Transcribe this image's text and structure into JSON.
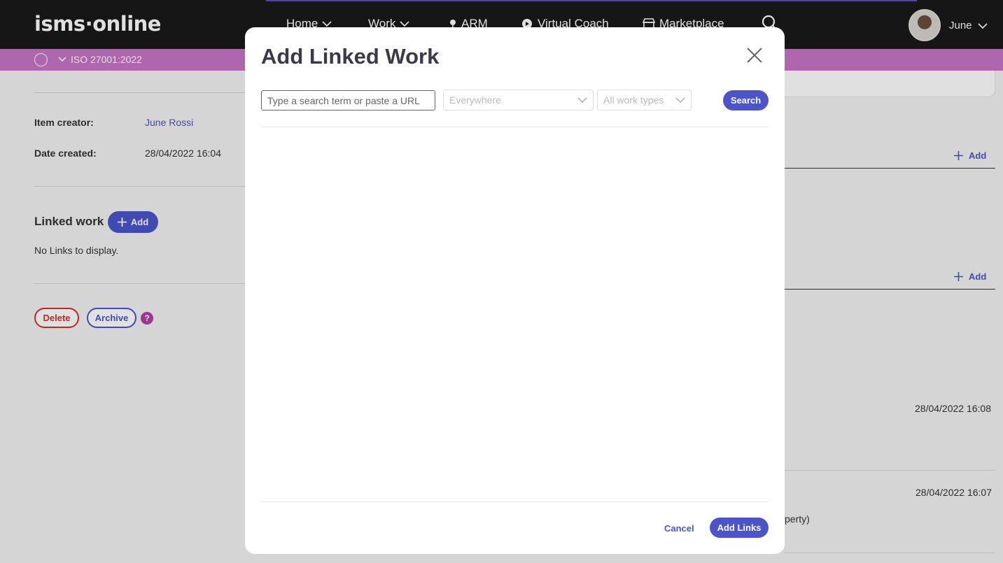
{
  "nav": {
    "logo": "isms·online",
    "items": [
      {
        "label": "Home"
      },
      {
        "label": "Work"
      },
      {
        "label": "ARM"
      },
      {
        "label": "Virtual Coach"
      },
      {
        "label": "Marketplace"
      }
    ],
    "user_name": "June"
  },
  "subbar": {
    "standard": "ISO 27001:2022"
  },
  "details": {
    "creator_label": "Item creator:",
    "creator_value": "June Rossi",
    "date_label": "Date created:",
    "date_value": "28/04/2022 16:04"
  },
  "linked_work": {
    "title": "Linked work",
    "add_label": "Add",
    "empty_text": "No Links to display."
  },
  "actions": {
    "delete_label": "Delete",
    "archive_label": "Archive",
    "help_glyph": "?"
  },
  "right_panel": {
    "add1": "Add",
    "add2": "Add",
    "timestamp1": "28/04/2022 16:08",
    "timestamp2": "28/04/2022 16:07",
    "fragment": "perty)"
  },
  "modal": {
    "title": "Add Linked Work",
    "search_placeholder": "Type a search term or paste a URL",
    "scope_select": "Everywhere",
    "type_select": "All work types",
    "search_button": "Search",
    "cancel_label": "Cancel",
    "add_links_label": "Add Links"
  },
  "colors": {
    "brand_primary": "#4b55c9",
    "subbar": "#c776c4",
    "nav_bg": "#1a1a1a",
    "danger": "#d0312d"
  }
}
